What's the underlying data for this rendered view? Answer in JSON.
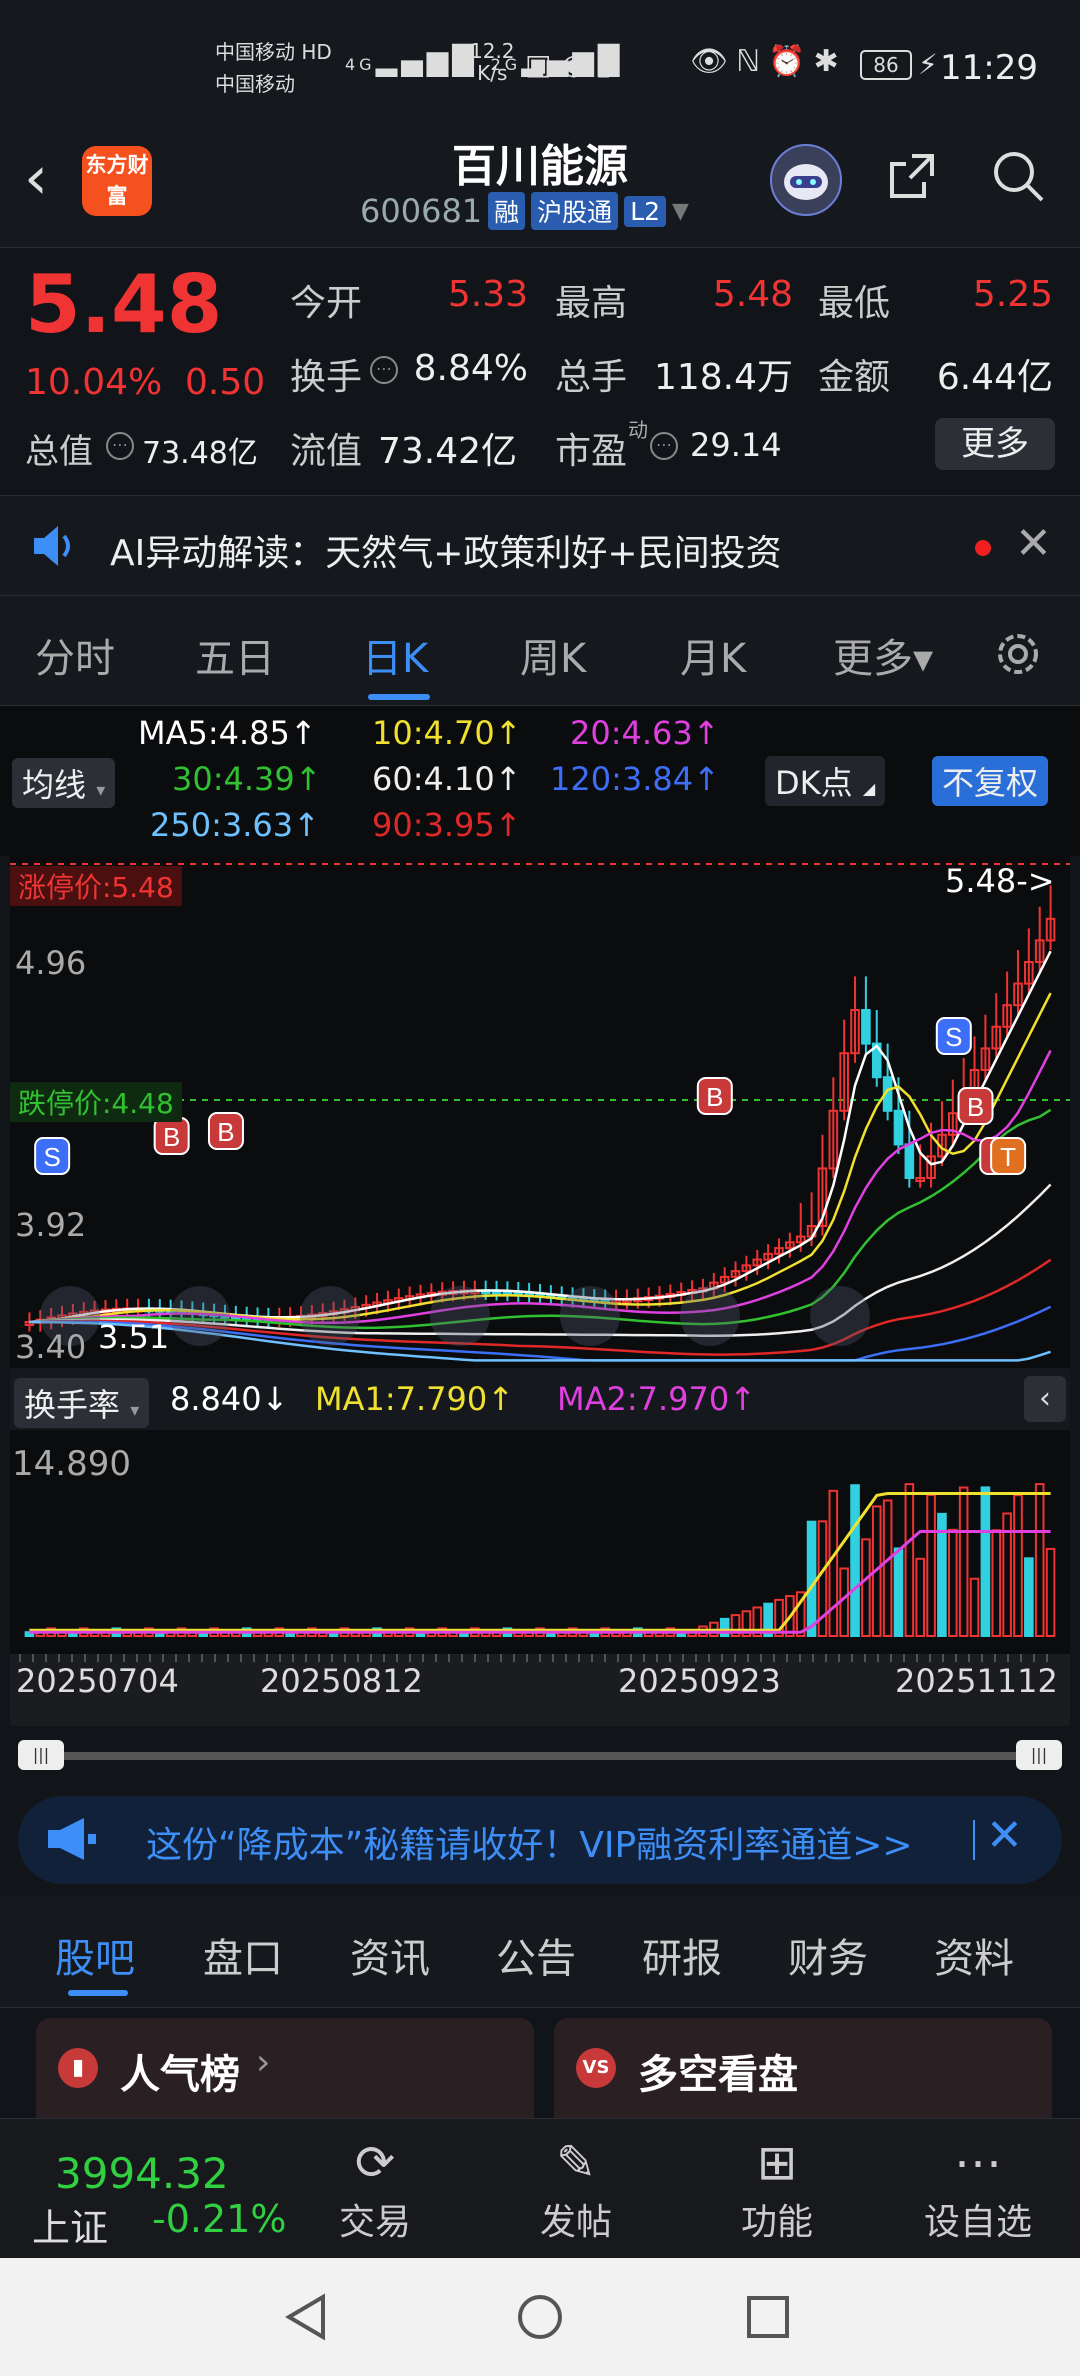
{
  "statusbar": {
    "carrier1": "中国移动 HD",
    "carrier2": "中国移动",
    "signal1": "4G",
    "signal2": "2G",
    "net_speed": "12.2\nK/s",
    "battery": "86",
    "time": "11:29"
  },
  "header": {
    "back_icon": "chevron-left-icon",
    "logo_text": "东方财富",
    "stock_name": "百川能源",
    "stock_code": "600681",
    "tags": [
      "融",
      "沪股通",
      "L2"
    ],
    "share_icon": "share-icon",
    "search_icon": "search-icon"
  },
  "quote": {
    "price": "5.48",
    "pct": "10.04%",
    "change": "0.50",
    "open_label": "今开",
    "open_value": "5.33",
    "high_label": "最高",
    "high_value": "5.48",
    "low_label": "最低",
    "low_value": "5.25",
    "turnover_label": "换手",
    "turnover_value": "8.84%",
    "volume_label": "总手",
    "volume_value": "118.4万",
    "amount_label": "金额",
    "amount_value": "6.44亿",
    "mktcap_label": "总值",
    "mktcap_value": "73.48亿",
    "float_label": "流值",
    "float_value": "73.42亿",
    "pe_label": "市盈",
    "pe_sup": "动",
    "pe_value": "29.14",
    "more_label": "更多",
    "red": "#f03333"
  },
  "ai": {
    "text": "AI异动解读：天然气+政策利好+民间投资"
  },
  "tabs": {
    "items": [
      "分时",
      "五日",
      "日K",
      "周K",
      "月K",
      "更多▾"
    ],
    "active": "日K"
  },
  "legend": {
    "ma_type": "均线",
    "ma5": "MA5:4.85↑",
    "ma10": "10:4.70↑",
    "ma20": "20:4.63↑",
    "ma30": "30:4.39↑",
    "ma60": "60:4.10↑",
    "ma120": "120:3.84↑",
    "ma250": "250:3.63↑",
    "ma90": "90:3.95↑",
    "dk_btn": "DK点",
    "fq_btn": "不复权"
  },
  "chart_data": {
    "type": "candlestick",
    "price_axis": [
      "5.48",
      "4.96",
      "3.92",
      "3.40"
    ],
    "limit_up_label": "涨停价:5.48",
    "limit_down_label": "跌停价:4.48",
    "last_label": "5.48->",
    "low_label": "3.51",
    "turnover_header": "换手率",
    "turnover_value": "8.840↓",
    "ma1": "MA1:7.790↑",
    "ma2": "MA2:7.970↑",
    "turnover_max": "14.890",
    "dates": [
      "20250704",
      "20250812",
      "20250923",
      "20251112"
    ],
    "markers": [
      "S",
      "B",
      "B",
      "B",
      "S",
      "B",
      "B",
      "T"
    ]
  },
  "promo": {
    "text": "这份“降成本”秘籍请收好！VIP融资利率通道>>"
  },
  "subtabs": {
    "items": [
      "股吧",
      "盘口",
      "资讯",
      "公告",
      "研报",
      "财务",
      "资料"
    ],
    "active": "股吧"
  },
  "cards": {
    "popular": "人气榜",
    "versus": "多空看盘"
  },
  "bottom": {
    "index_value": "3994.32",
    "index_name": "上证",
    "index_change": "-0.21%",
    "trade": "交易",
    "post": "发帖",
    "func": "功能",
    "watch": "设自选"
  }
}
